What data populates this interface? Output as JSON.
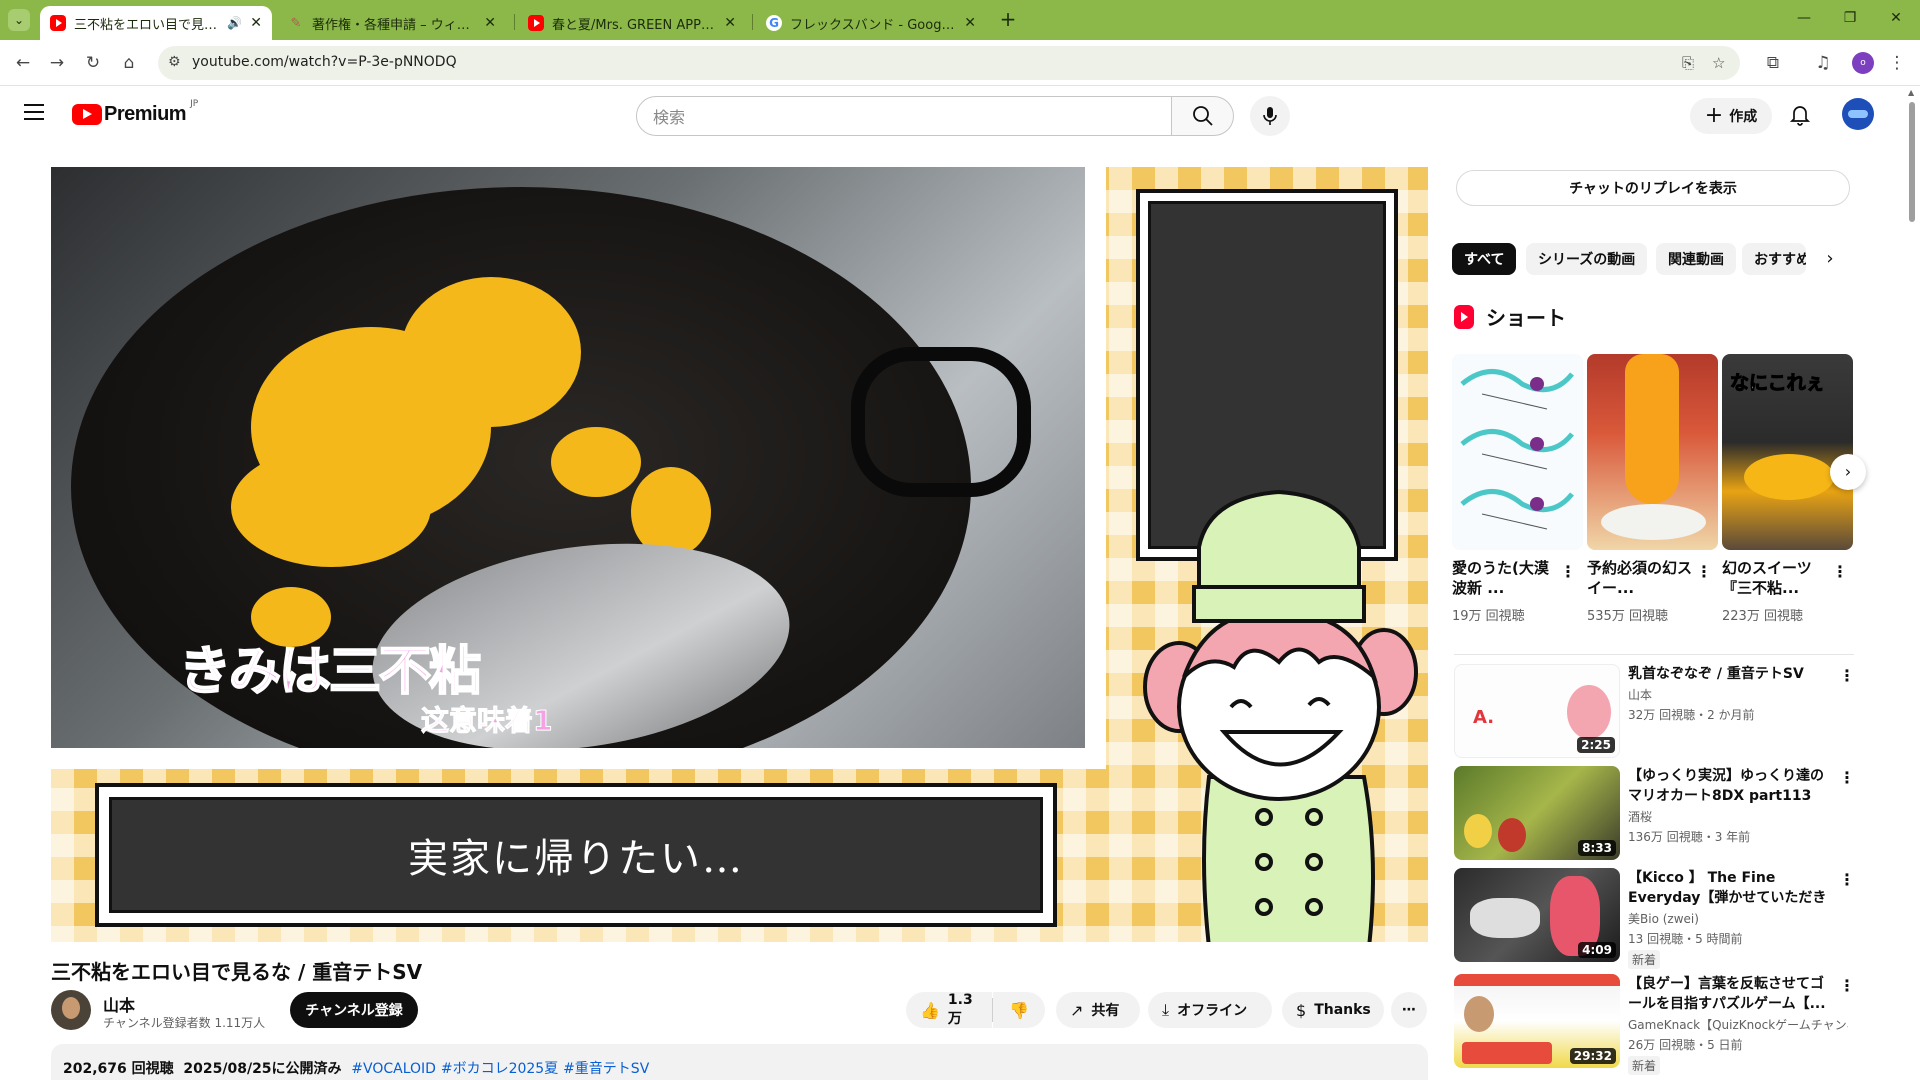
{
  "browser": {
    "tabs": [
      {
        "label": "三不粘をエロい目で見るな / 重",
        "icon": "youtube-icon",
        "active": true
      },
      {
        "label": "著作権・各種申請 – ウィンズスコア",
        "icon": "pen-icon",
        "active": false
      },
      {
        "label": "春と夏/Mrs. GREEN APPLE【大阪",
        "icon": "youtube-icon",
        "active": false
      },
      {
        "label": "フレックスバンド - Google 検索",
        "icon": "google-icon",
        "active": false
      }
    ],
    "url": "youtube.com/watch?v=P-3e-pNNODQ",
    "profile_initial": "o"
  },
  "masthead": {
    "logo_text": "Premium",
    "region": "JP",
    "search_placeholder": "検索",
    "create_label": "作成"
  },
  "player": {
    "caption_big": "きみは三不粘",
    "caption_small": "这意味着1",
    "subtitle": "実家に帰りたい…"
  },
  "video": {
    "title": "三不粘をエロい目で見るな / 重音テトSV",
    "channel": "山本",
    "subscribers": "チャンネル登録者数 1.11万人",
    "subscribe_label": "チャンネル登録",
    "likes": "1.3万",
    "share_label": "共有",
    "offline_label": "オフライン",
    "thanks_label": "Thanks",
    "views": "202,676 回視聴",
    "published": "2025/08/25に公開済み",
    "tags": [
      "#VOCALOID",
      "#ボカコレ2025夏",
      "#重音テトSV"
    ]
  },
  "sidebar": {
    "chat_replay": "チャットのリプレイを表示",
    "chips": [
      "すべて",
      "シリーズの動画",
      "関連動画",
      "おすすめ"
    ],
    "shorts_heading": "ショート",
    "shorts": [
      {
        "title": "愛のうた(大漠波新 ...",
        "views": "19万 回視聴"
      },
      {
        "title": "予約必須の幻スイー...",
        "views": "535万 回視聴"
      },
      {
        "title": "幻のスイーツ『三不粘...",
        "views": "223万 回視聴",
        "overlay": "なにこれぇ"
      }
    ],
    "recommendations": [
      {
        "title": "乳首なぞなぞ / 重音テトSV",
        "channel": "山本",
        "meta": "32万 回視聴・2 か月前",
        "duration": "2:25",
        "badge": ""
      },
      {
        "title": "【ゆっくり実況】ゆっくり達のマリオカート8DX part113",
        "channel": "酒桜",
        "meta": "136万 回視聴・3 年前",
        "duration": "8:33",
        "badge": ""
      },
      {
        "title": "【Kicco 】 The Fine Everyday【弾かせていただきました】",
        "channel": "美Bio (zwei)",
        "meta": "13 回視聴・5 時間前",
        "duration": "4:09",
        "badge": "新着"
      },
      {
        "title": "【良ゲー】言葉を反転させてゴールを目指すパズルゲーム【...",
        "channel": "GameKnack【QuizKnockゲームチャンネル】",
        "meta": "26万 回視聴・5 日前",
        "duration": "29:32",
        "badge": "新着"
      }
    ]
  },
  "colors": {
    "tabstrip": "#8cb84a",
    "youtube_red": "#ff0000",
    "link_blue": "#065fd4"
  }
}
